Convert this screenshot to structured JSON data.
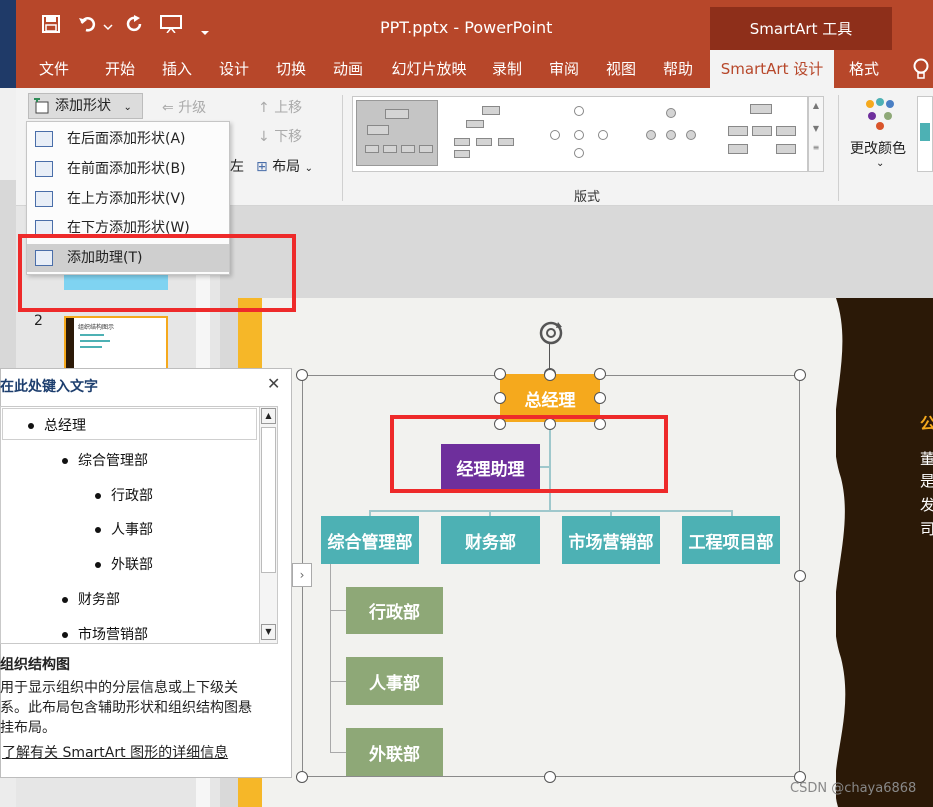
{
  "window": {
    "doc_title": "PPT.pptx - PowerPoint",
    "context_header": "SmartArt 工具"
  },
  "tabs": [
    "文件",
    "开始",
    "插入",
    "设计",
    "切换",
    "动画",
    "幻灯片放映",
    "录制",
    "审阅",
    "视图",
    "帮助",
    "SmartArt 设计",
    "格式"
  ],
  "ribbon": {
    "add_shape": "添加形状",
    "promote": "升级",
    "demote": "降级",
    "move_up": "上移",
    "move_down": "下移",
    "right_to_left_partial": "左",
    "layout": "布局",
    "layouts_group": "版式",
    "change_colors": "更改颜色"
  },
  "menu": {
    "items": [
      "在后面添加形状(A)",
      "在前面添加形状(B)",
      "在上方添加形状(V)",
      "在下方添加形状(W)",
      "添加助理(T)"
    ]
  },
  "thumbnails": {
    "slide2_number": "2",
    "slide2_title": "组织结构图示"
  },
  "text_pane": {
    "title": "在此处键入文字",
    "items": [
      "总经理",
      "综合管理部",
      "行政部",
      "人事部",
      "外联部",
      "财务部",
      "市场营销部"
    ],
    "desc_title": "组织结构图",
    "desc_body": "用于显示组织中的分层信息或上下级关系。此布局包含辅助形状和组织结构图悬挂布局。",
    "link": "了解有关 SmartArt 图形的详细信息"
  },
  "smartart": {
    "root": "总经理",
    "assistant": "经理助理",
    "departments": [
      "综合管理部",
      "财务部",
      "市场营销部",
      "工程项目部"
    ],
    "sub_departments": [
      "行政部",
      "人事部",
      "外联部"
    ]
  },
  "slide_side_text": [
    "公",
    "董",
    "是",
    "发",
    "司"
  ],
  "watermark": "CSDN @chaya6868",
  "colors": {
    "titlebar": "#b7472a",
    "root_node": "#f5a91d",
    "assistant_node": "#6e2f9c",
    "dept_node": "#4db1b4",
    "subdept_node": "#8ea877",
    "highlight": "#ee2a2a"
  }
}
